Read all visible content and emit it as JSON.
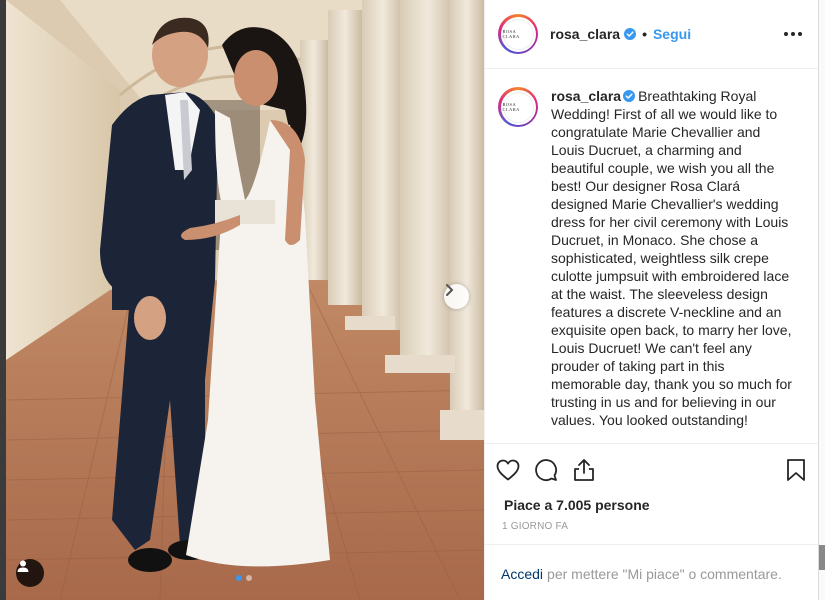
{
  "post": {
    "username": "rosa_clara",
    "avatar_text": "ROSA CLARA",
    "follow_label": "Segui",
    "separator": "•"
  },
  "caption": {
    "username": "rosa_clara",
    "text": "Breathtaking Royal Wedding! First of all we would like to congratulate Marie Chevallier and Louis Ducruet, a charming and beautiful couple, we wish you all the best! Our designer Rosa Clará designed Marie Chevallier's wedding dress for her civil ceremony with Louis Ducruet, in Monaco. She chose a sophisticated, weightless silk crepe culotte jumpsuit with embroidered lace at the waist. The sleeveless design features a discrete V-neckline and an exquisite open back, to marry her love, Louis Ducruet! We can't feel any prouder of taking part in this memorable day, thank you so much for trusting in us and for believing in our values. You looked outstanding!"
  },
  "likes": "Piace a 7.005 persone",
  "timestamp": "1 GIORNO FA",
  "comment": {
    "login_label": "Accedi",
    "rest": "per mettere \"Mi piace\" o commentare."
  },
  "icons": {
    "verified": "verified-badge-icon",
    "like": "heart-icon",
    "comment": "comment-bubble-icon",
    "share": "share-icon",
    "save": "bookmark-icon",
    "more": "more-options-icon",
    "next": "chevron-right-icon",
    "tag": "user-tag-icon"
  },
  "colors": {
    "accent": "#3897f0",
    "text": "#262626",
    "muted": "#999999",
    "link": "#00376b"
  },
  "carousel": {
    "total": 2,
    "current": 1
  }
}
